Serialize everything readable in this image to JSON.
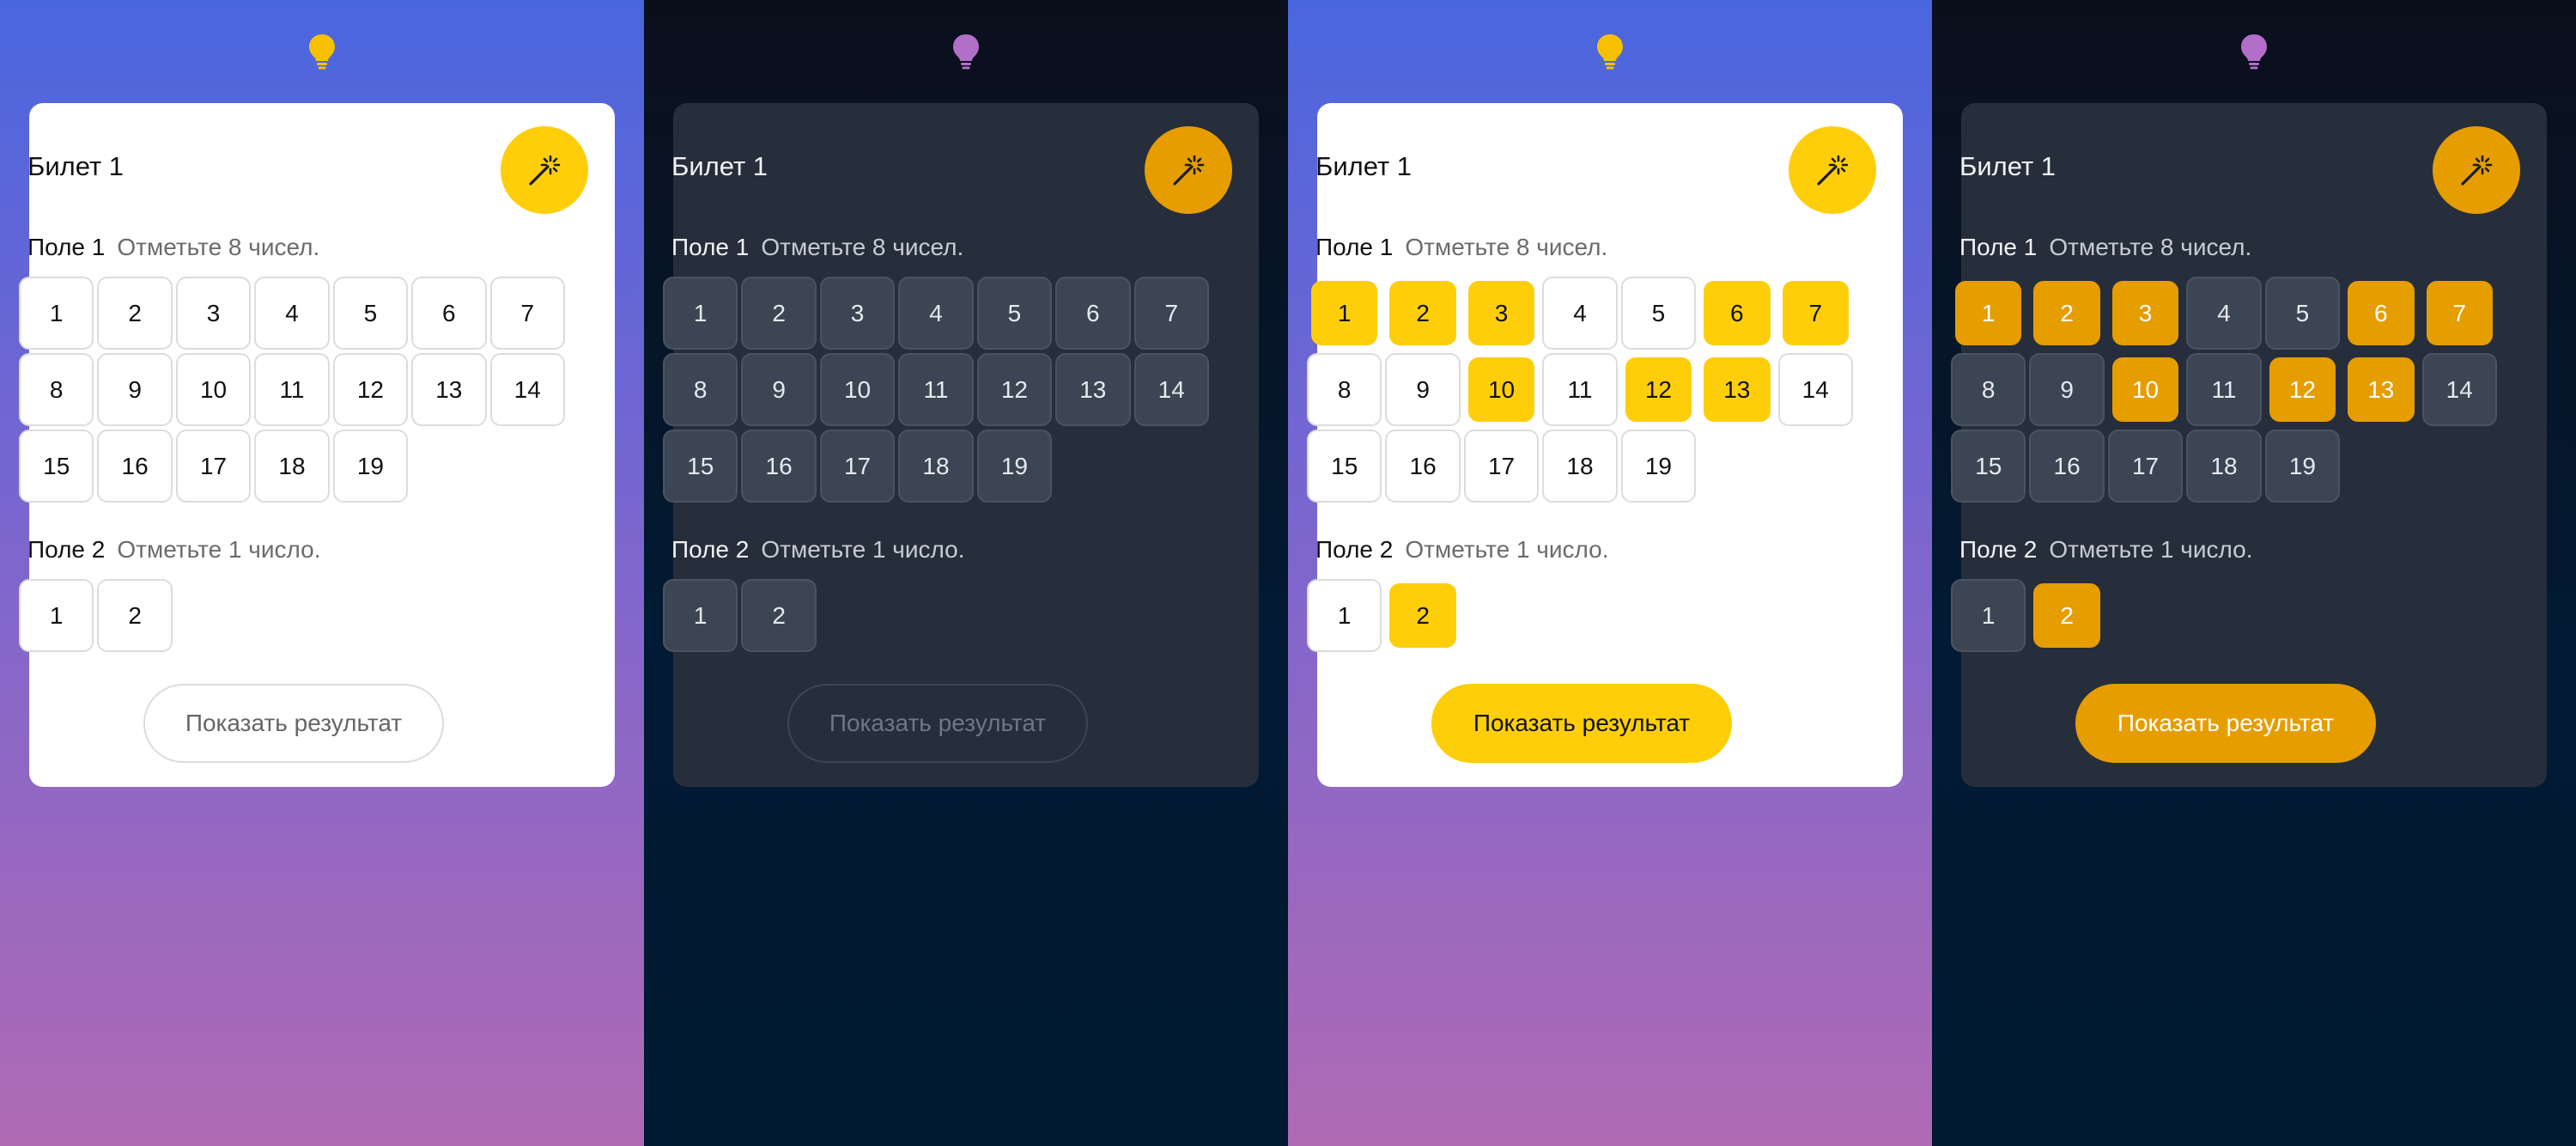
{
  "colors": {
    "light_accent": "#fece0b",
    "dark_accent": "#e69d00",
    "light_bulb": "#f6c000",
    "dark_bulb": "#b36ec9"
  },
  "panels": [
    {
      "theme": "light",
      "bulb_icon": "lightbulb-icon",
      "ticket_title": "Билет 1",
      "wand_icon": "magic-wand-icon",
      "field1": {
        "name": "Поле 1",
        "hint": "Отметьте 8 чисел.",
        "numbers": [
          "1",
          "2",
          "3",
          "4",
          "5",
          "6",
          "7",
          "8",
          "9",
          "10",
          "11",
          "12",
          "13",
          "14",
          "15",
          "16",
          "17",
          "18",
          "19"
        ],
        "selected": []
      },
      "field2": {
        "name": "Поле 2",
        "hint": "Отметьте 1 число.",
        "numbers": [
          "1",
          "2"
        ],
        "selected": []
      },
      "result_button": "Показать результат",
      "result_enabled": false
    },
    {
      "theme": "dark",
      "bulb_icon": "lightbulb-icon",
      "ticket_title": "Билет 1",
      "wand_icon": "magic-wand-icon",
      "field1": {
        "name": "Поле 1",
        "hint": "Отметьте 8 чисел.",
        "numbers": [
          "1",
          "2",
          "3",
          "4",
          "5",
          "6",
          "7",
          "8",
          "9",
          "10",
          "11",
          "12",
          "13",
          "14",
          "15",
          "16",
          "17",
          "18",
          "19"
        ],
        "selected": []
      },
      "field2": {
        "name": "Поле 2",
        "hint": "Отметьте 1 число.",
        "numbers": [
          "1",
          "2"
        ],
        "selected": []
      },
      "result_button": "Показать результат",
      "result_enabled": false
    },
    {
      "theme": "light",
      "bulb_icon": "lightbulb-icon",
      "ticket_title": "Билет 1",
      "wand_icon": "magic-wand-icon",
      "field1": {
        "name": "Поле 1",
        "hint": "Отметьте 8 чисел.",
        "numbers": [
          "1",
          "2",
          "3",
          "4",
          "5",
          "6",
          "7",
          "8",
          "9",
          "10",
          "11",
          "12",
          "13",
          "14",
          "15",
          "16",
          "17",
          "18",
          "19"
        ],
        "selected": [
          "1",
          "2",
          "3",
          "6",
          "7",
          "10",
          "12",
          "13"
        ]
      },
      "field2": {
        "name": "Поле 2",
        "hint": "Отметьте 1 число.",
        "numbers": [
          "1",
          "2"
        ],
        "selected": [
          "2"
        ]
      },
      "result_button": "Показать результат",
      "result_enabled": true
    },
    {
      "theme": "dark",
      "bulb_icon": "lightbulb-icon",
      "ticket_title": "Билет 1",
      "wand_icon": "magic-wand-icon",
      "field1": {
        "name": "Поле 1",
        "hint": "Отметьте 8 чисел.",
        "numbers": [
          "1",
          "2",
          "3",
          "4",
          "5",
          "6",
          "7",
          "8",
          "9",
          "10",
          "11",
          "12",
          "13",
          "14",
          "15",
          "16",
          "17",
          "18",
          "19"
        ],
        "selected": [
          "1",
          "2",
          "3",
          "6",
          "7",
          "10",
          "12",
          "13"
        ]
      },
      "field2": {
        "name": "Поле 2",
        "hint": "Отметьте 1 число.",
        "numbers": [
          "1",
          "2"
        ],
        "selected": [
          "2"
        ]
      },
      "result_button": "Показать результат",
      "result_enabled": true
    }
  ]
}
